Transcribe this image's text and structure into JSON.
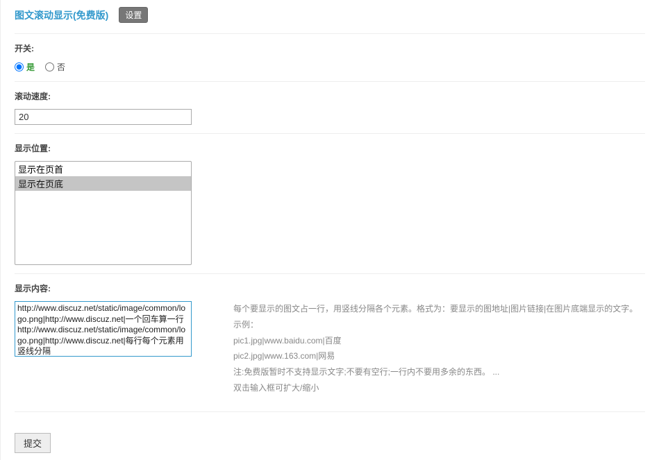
{
  "header": {
    "title": "图文滚动显示(免费版)",
    "settings_label": "设置"
  },
  "switch": {
    "label": "开关:",
    "yes": "是",
    "no": "否",
    "selected": "yes"
  },
  "speed": {
    "label": "滚动速度:",
    "value": "20"
  },
  "position": {
    "label": "显示位置:",
    "options": [
      "显示在页首",
      "显示在页底"
    ],
    "selected_index": 1
  },
  "content": {
    "label": "显示内容:",
    "value": "http://www.discuz.net/static/image/common/logo.png|http://www.discuz.net|一个回车算一行\nhttp://www.discuz.net/static/image/common/logo.png|http://www.discuz.net|每行每个元素用竖线分隔",
    "help": {
      "line1": "每个要显示的图文占一行，用竖线分隔各个元素。格式为：要显示的图地址|图片链接|在图片底端显示的文字。",
      "line2": "示例：",
      "line3": "pic1.jpg|www.baidu.com|百度",
      "line4": "pic2.jpg|www.163.com|网易",
      "line5": "注:免费版暂时不支持显示文字;不要有空行;一行内不要用多余的东西。 ...",
      "line6": "双击输入框可扩大/缩小"
    }
  },
  "submit": {
    "label": "提交"
  }
}
